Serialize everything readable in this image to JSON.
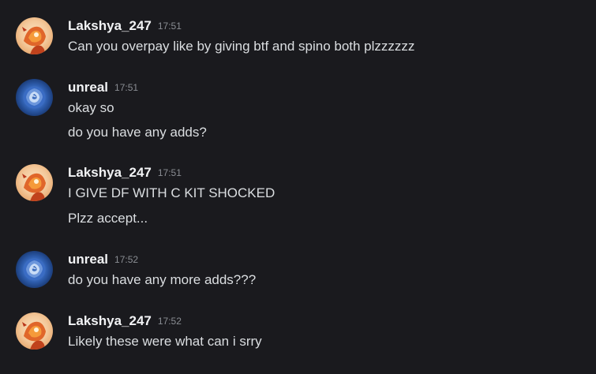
{
  "messages": [
    {
      "username": "Lakshya_247",
      "timestamp": "17:51",
      "avatar_icon": "fiery-character-avatar-icon",
      "lines": [
        "Can you overpay like by giving btf and spino both plzzzzzz"
      ]
    },
    {
      "username": "unreal",
      "timestamp": "17:51",
      "avatar_icon": "blue-rose-avatar-icon",
      "lines": [
        "okay so",
        "do you have any adds?"
      ]
    },
    {
      "username": "Lakshya_247",
      "timestamp": "17:51",
      "avatar_icon": "fiery-character-avatar-icon",
      "lines": [
        "I GIVE DF WITH C KIT SHOCKED",
        "Plzz accept..."
      ]
    },
    {
      "username": "unreal",
      "timestamp": "17:52",
      "avatar_icon": "blue-rose-avatar-icon",
      "lines": [
        "do you have any more adds???"
      ]
    },
    {
      "username": "Lakshya_247",
      "timestamp": "17:52",
      "avatar_icon": "fiery-character-avatar-icon",
      "lines": [
        "Likely these were what can i srry"
      ]
    }
  ],
  "colors": {
    "background": "#1a1a1e",
    "username": "#f2f3f5",
    "text": "#dbdee1",
    "timestamp": "#8a8d93"
  }
}
